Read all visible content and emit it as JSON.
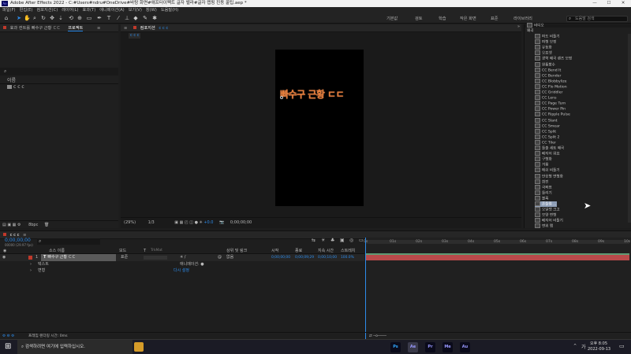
{
  "window": {
    "title": "Adobe After Effects 2022 - C:#Users#ndru#OneDrive#바탕 화면#애프터이펙트 글자 밸라#글자 랩핑 진동 꿀팁.aep *",
    "minimize": "—",
    "maximize": "☐",
    "close": "✕"
  },
  "menu": [
    "파일(F)",
    "편집(E)",
    "컴포지션(C)",
    "레이어(L)",
    "효과(T)",
    "애니메이션(A)",
    "보기(V)",
    "창(W)",
    "도움말(H)"
  ],
  "workspaces": [
    "기본값",
    "검토",
    "학습",
    "작은 화면",
    "표준",
    "라이브러리"
  ],
  "search_help": {
    "placeholder": "도움말 검색"
  },
  "project": {
    "tab_fx": "효과 컨트롤 빠수구 근황 ㄷㄷ",
    "tab_project": "프로젝트",
    "col_name": "이름",
    "item_name": "c c c",
    "bpc": "8bpc"
  },
  "comp": {
    "tab": "컴포지션",
    "name": "c c c",
    "zoom": "(29%)",
    "resolution": "1/3",
    "exposure": "+0.0",
    "timecode": "0;00;00;00",
    "text": "빠수구 근황 ㄷㄷ"
  },
  "effects": {
    "header": "비디오",
    "sub": "왜곡",
    "items": [
      "파도 비틀기",
      "파형 보정",
      "유동화",
      "오프셋",
      "광학 왜곡 렌즈 보정",
      "원통함수",
      "CC Bend It",
      "CC Bender",
      "CC Blobbylize",
      "CC Flo Motion",
      "CC Griddler",
      "CC Lens",
      "CC Page Turn",
      "CC Power Pin",
      "CC Ripple Pulse",
      "CC Slant",
      "CC Smear",
      "CC Split",
      "CC Split 2",
      "CC Tiler",
      "돌출 세트 왜곡",
      "베지어 워프",
      "구형화",
      "거품",
      "메쉬 비틀기",
      "반응형 변형화",
      "회전",
      "극좌표",
      "돌리기",
      "볼록",
      "흔들림 ...",
      "오일렛 크고",
      "모양 변형",
      "베지어 비틀기",
      "변위 맵"
    ]
  },
  "timeline": {
    "tab": "c c c",
    "timecode": "0;00;00;00",
    "fps": "00000 (29.97 fps)",
    "cols": [
      "소스 이름",
      "모드",
      "T",
      "TrkMat",
      "상위 및 링크",
      "시작",
      "종료",
      "지속 시간",
      "스트레치"
    ],
    "layer": {
      "num": "1",
      "name": "빠수구 근황 ㄷㄷ",
      "mode": "표준",
      "parent": "없음",
      "start": "0;00;00;00",
      "end": "0;00;09;29",
      "dur": "0;00;10;00",
      "stretch": "100.0%"
    },
    "sub1": "텍스트",
    "sub1_val": "애니메이션: ●",
    "sub2": "변형",
    "sub2_val": "다시 설정",
    "ruler": [
      "0s",
      "01s",
      "02s",
      "03s",
      "04s",
      "05s",
      "06s",
      "07s",
      "08s",
      "09s",
      "10s"
    ],
    "footer": "프레임 렌더링 시간: 0ms"
  },
  "taskbar": {
    "search": "검색하려면 여기에 입력하십시오.",
    "apps": [
      {
        "label": "Ps",
        "color": "#31a8ff"
      },
      {
        "label": "Ae",
        "color": "#9999ff"
      },
      {
        "label": "Pr",
        "color": "#9999ff"
      },
      {
        "label": "Me",
        "color": "#9999ff"
      },
      {
        "label": "Au",
        "color": "#9999ff"
      }
    ],
    "lang": "가",
    "time": "오후 8:05",
    "date": "2022-09-13"
  },
  "colors": {
    "accent": "#2d8ceb",
    "label_red": "#c0392b",
    "orange_text": "#e47d3a"
  }
}
